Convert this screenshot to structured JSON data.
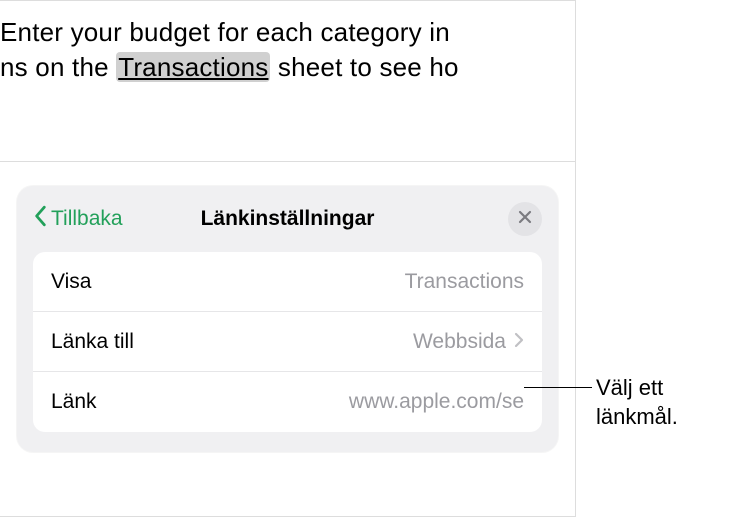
{
  "document": {
    "line1": "Enter your budget for each category in",
    "line2_prefix": "ns on the ",
    "line2_link": "Transactions",
    "line2_suffix": " sheet to see ho"
  },
  "popover": {
    "back_label": "Tillbaka",
    "title": "Länkinställningar",
    "rows": {
      "display": {
        "label": "Visa",
        "value": "Transactions"
      },
      "link_to": {
        "label": "Länka till",
        "value": "Webbsida"
      },
      "link": {
        "label": "Länk",
        "value": "www.apple.com/se"
      }
    }
  },
  "callout": {
    "line1": "Välj ett",
    "line2": "länkmål."
  }
}
